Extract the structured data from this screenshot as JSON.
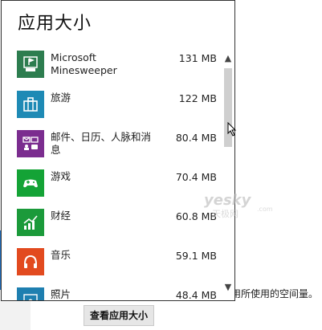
{
  "panel": {
    "title": "应用大小"
  },
  "apps": [
    {
      "name": "Microsoft Minesweeper",
      "size": "131 MB",
      "icon": "minesweeper-flag-icon",
      "color": "#2d7d4f"
    },
    {
      "name": "旅游",
      "size": "122 MB",
      "icon": "suitcase-icon",
      "color": "#1e8ab5"
    },
    {
      "name": "邮件、日历、人脉和消息",
      "size": "80.4 MB",
      "icon": "mail-calendar-icon",
      "color": "#7b2d8f"
    },
    {
      "name": "游戏",
      "size": "70.4 MB",
      "icon": "game-controller-icon",
      "color": "#14a336"
    },
    {
      "name": "财经",
      "size": "60.8 MB",
      "icon": "finance-chart-icon",
      "color": "#1b9a3a"
    },
    {
      "name": "音乐",
      "size": "59.1 MB",
      "icon": "headphones-icon",
      "color": "#e24a1f"
    },
    {
      "name": "照片",
      "size": "48.4 MB",
      "icon": "photo-icon",
      "color": "#1e7fb0"
    }
  ],
  "background": {
    "description_fragment": "用所使用的空间量。",
    "view_sizes_button": "查看应用大小"
  },
  "watermark": {
    "text": "yesky",
    "subtext": "天极网",
    "suffix": ".com"
  }
}
